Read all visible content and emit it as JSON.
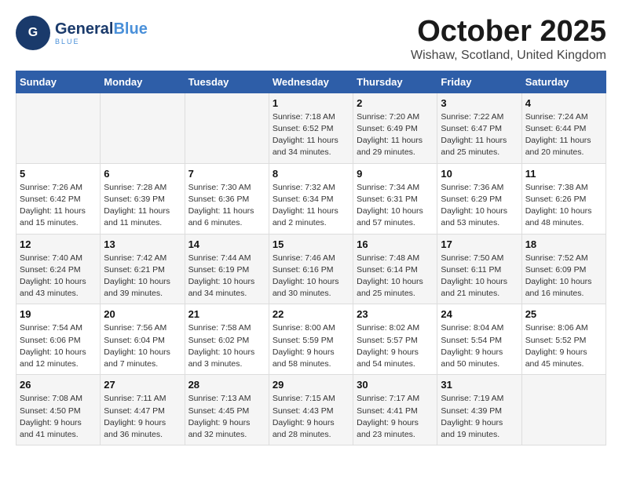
{
  "header": {
    "logo": {
      "line1": "General",
      "line2": "Blue"
    },
    "title": "October 2025",
    "location": "Wishaw, Scotland, United Kingdom"
  },
  "weekdays": [
    "Sunday",
    "Monday",
    "Tuesday",
    "Wednesday",
    "Thursday",
    "Friday",
    "Saturday"
  ],
  "weeks": [
    [
      {
        "day": "",
        "info": ""
      },
      {
        "day": "",
        "info": ""
      },
      {
        "day": "",
        "info": ""
      },
      {
        "day": "1",
        "info": "Sunrise: 7:18 AM\nSunset: 6:52 PM\nDaylight: 11 hours\nand 34 minutes."
      },
      {
        "day": "2",
        "info": "Sunrise: 7:20 AM\nSunset: 6:49 PM\nDaylight: 11 hours\nand 29 minutes."
      },
      {
        "day": "3",
        "info": "Sunrise: 7:22 AM\nSunset: 6:47 PM\nDaylight: 11 hours\nand 25 minutes."
      },
      {
        "day": "4",
        "info": "Sunrise: 7:24 AM\nSunset: 6:44 PM\nDaylight: 11 hours\nand 20 minutes."
      }
    ],
    [
      {
        "day": "5",
        "info": "Sunrise: 7:26 AM\nSunset: 6:42 PM\nDaylight: 11 hours\nand 15 minutes."
      },
      {
        "day": "6",
        "info": "Sunrise: 7:28 AM\nSunset: 6:39 PM\nDaylight: 11 hours\nand 11 minutes."
      },
      {
        "day": "7",
        "info": "Sunrise: 7:30 AM\nSunset: 6:36 PM\nDaylight: 11 hours\nand 6 minutes."
      },
      {
        "day": "8",
        "info": "Sunrise: 7:32 AM\nSunset: 6:34 PM\nDaylight: 11 hours\nand 2 minutes."
      },
      {
        "day": "9",
        "info": "Sunrise: 7:34 AM\nSunset: 6:31 PM\nDaylight: 10 hours\nand 57 minutes."
      },
      {
        "day": "10",
        "info": "Sunrise: 7:36 AM\nSunset: 6:29 PM\nDaylight: 10 hours\nand 53 minutes."
      },
      {
        "day": "11",
        "info": "Sunrise: 7:38 AM\nSunset: 6:26 PM\nDaylight: 10 hours\nand 48 minutes."
      }
    ],
    [
      {
        "day": "12",
        "info": "Sunrise: 7:40 AM\nSunset: 6:24 PM\nDaylight: 10 hours\nand 43 minutes."
      },
      {
        "day": "13",
        "info": "Sunrise: 7:42 AM\nSunset: 6:21 PM\nDaylight: 10 hours\nand 39 minutes."
      },
      {
        "day": "14",
        "info": "Sunrise: 7:44 AM\nSunset: 6:19 PM\nDaylight: 10 hours\nand 34 minutes."
      },
      {
        "day": "15",
        "info": "Sunrise: 7:46 AM\nSunset: 6:16 PM\nDaylight: 10 hours\nand 30 minutes."
      },
      {
        "day": "16",
        "info": "Sunrise: 7:48 AM\nSunset: 6:14 PM\nDaylight: 10 hours\nand 25 minutes."
      },
      {
        "day": "17",
        "info": "Sunrise: 7:50 AM\nSunset: 6:11 PM\nDaylight: 10 hours\nand 21 minutes."
      },
      {
        "day": "18",
        "info": "Sunrise: 7:52 AM\nSunset: 6:09 PM\nDaylight: 10 hours\nand 16 minutes."
      }
    ],
    [
      {
        "day": "19",
        "info": "Sunrise: 7:54 AM\nSunset: 6:06 PM\nDaylight: 10 hours\nand 12 minutes."
      },
      {
        "day": "20",
        "info": "Sunrise: 7:56 AM\nSunset: 6:04 PM\nDaylight: 10 hours\nand 7 minutes."
      },
      {
        "day": "21",
        "info": "Sunrise: 7:58 AM\nSunset: 6:02 PM\nDaylight: 10 hours\nand 3 minutes."
      },
      {
        "day": "22",
        "info": "Sunrise: 8:00 AM\nSunset: 5:59 PM\nDaylight: 9 hours\nand 58 minutes."
      },
      {
        "day": "23",
        "info": "Sunrise: 8:02 AM\nSunset: 5:57 PM\nDaylight: 9 hours\nand 54 minutes."
      },
      {
        "day": "24",
        "info": "Sunrise: 8:04 AM\nSunset: 5:54 PM\nDaylight: 9 hours\nand 50 minutes."
      },
      {
        "day": "25",
        "info": "Sunrise: 8:06 AM\nSunset: 5:52 PM\nDaylight: 9 hours\nand 45 minutes."
      }
    ],
    [
      {
        "day": "26",
        "info": "Sunrise: 7:08 AM\nSunset: 4:50 PM\nDaylight: 9 hours\nand 41 minutes."
      },
      {
        "day": "27",
        "info": "Sunrise: 7:11 AM\nSunset: 4:47 PM\nDaylight: 9 hours\nand 36 minutes."
      },
      {
        "day": "28",
        "info": "Sunrise: 7:13 AM\nSunset: 4:45 PM\nDaylight: 9 hours\nand 32 minutes."
      },
      {
        "day": "29",
        "info": "Sunrise: 7:15 AM\nSunset: 4:43 PM\nDaylight: 9 hours\nand 28 minutes."
      },
      {
        "day": "30",
        "info": "Sunrise: 7:17 AM\nSunset: 4:41 PM\nDaylight: 9 hours\nand 23 minutes."
      },
      {
        "day": "31",
        "info": "Sunrise: 7:19 AM\nSunset: 4:39 PM\nDaylight: 9 hours\nand 19 minutes."
      },
      {
        "day": "",
        "info": ""
      }
    ]
  ]
}
